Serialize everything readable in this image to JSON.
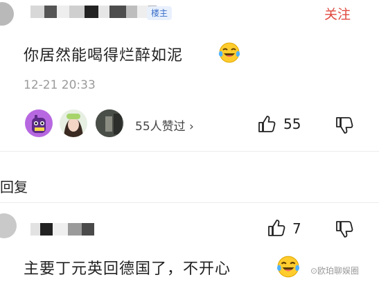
{
  "comment": {
    "owner_badge": "楼主",
    "follow_label": "关注",
    "text": "你居然能喝得烂醉如泥",
    "emoji": "crying-laughing-emoji",
    "timestamp": "12-21 20:33",
    "likes_text": "55人赞过",
    "likes_chevron": "›",
    "like_count": "55"
  },
  "reply_header": "回复",
  "reply": {
    "like_count": "7",
    "text": "主要丁元英回德国了，不开心",
    "emoji": "crying-laughing-emoji"
  },
  "watermark": "⊙欧珀聊娱圈",
  "colors": {
    "accent": "#e0483e",
    "badge_text": "#3a6ec9",
    "muted": "#9a9a9a"
  }
}
